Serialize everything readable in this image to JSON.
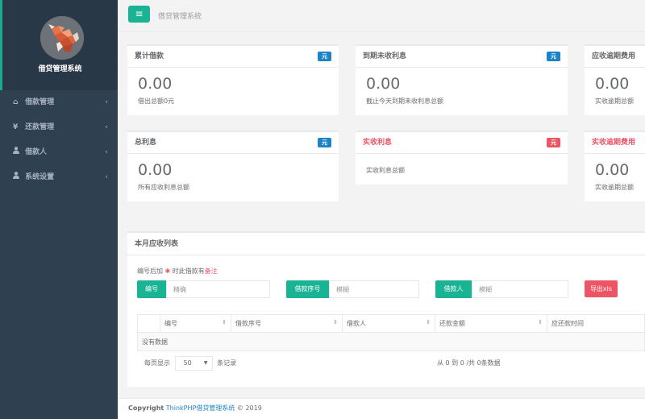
{
  "sidebar": {
    "system_name": "借贷管理系统",
    "items": [
      {
        "icon": "home-icon",
        "glyph": "⌂",
        "label": "借款管理"
      },
      {
        "icon": "yen-icon",
        "glyph": "¥",
        "label": "还款管理"
      },
      {
        "icon": "user-icon",
        "glyph": "●",
        "label": "借款人"
      },
      {
        "icon": "user-icon",
        "glyph": "●",
        "label": "系统设置"
      }
    ]
  },
  "topbar": {
    "title": "借贷管理系统"
  },
  "cards": [
    {
      "title": "累计借款",
      "badge": "元",
      "value": "0.00",
      "sub": "借出总额0元"
    },
    {
      "title": "到期未收利息",
      "badge": "元",
      "value": "0.00",
      "sub": "截止今天到期未收利息总额"
    },
    {
      "title": "应收逾期费用",
      "value": "0.00",
      "sub": "实收逾期总额"
    },
    {
      "title": "总利息",
      "badge": "元",
      "value": "0.00",
      "sub": "所有应收利息总额"
    },
    {
      "title": "实收利息",
      "badge": "元",
      "sub": "实收利息总额"
    },
    {
      "title": "实收逾期费用",
      "value": "0.00",
      "sub": "实收逾期总额"
    }
  ],
  "panel": {
    "title": "本月应收列表",
    "note_prefix": "编号后加",
    "note_star": "✱",
    "note_mid": "时此借款有",
    "note_suffix": "备注",
    "filters": [
      {
        "label": "编号",
        "placeholder": "精确"
      },
      {
        "label": "借款序号",
        "placeholder": "模糊"
      },
      {
        "label": "借款人",
        "placeholder": "模糊"
      }
    ],
    "export_label": "导出xls",
    "columns": [
      "编号",
      "借款序号",
      "借款人",
      "还款金额",
      "应还款时间"
    ],
    "empty_text": "没有数据",
    "pager": {
      "prefix": "每页显示",
      "page_size": "50",
      "suffix": "条记录"
    },
    "summary": "从 0 到 0 /共 0条数据"
  },
  "footer": {
    "copyright": "Copyright",
    "link": "ThinkPHP借贷管理系统",
    "year": "© 2019"
  },
  "colors": {
    "primary": "#1ab394",
    "danger": "#ed5565",
    "info": "#1c84c6",
    "sidebar": "#2f4050"
  }
}
